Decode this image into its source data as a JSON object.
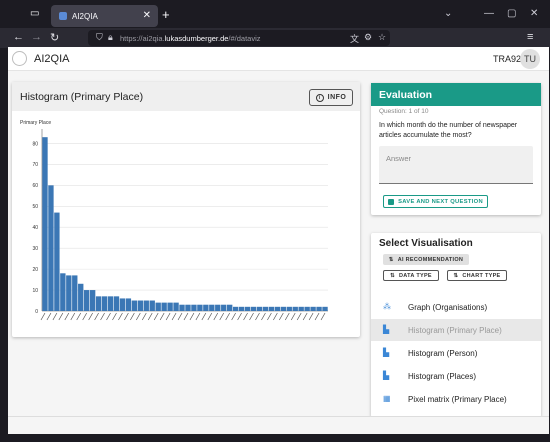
{
  "browser": {
    "tab_title": "AI2QIA",
    "url_prefix": "https://ai2qia.",
    "url_host": "lukasdumberger.de",
    "url_suffix": "/#/dataviz"
  },
  "app": {
    "title": "AI2QIA",
    "user_id": "TRA92",
    "avatar_initials": "TU"
  },
  "histogram_card": {
    "title": "Histogram (Primary Place)",
    "info_label": "INFO"
  },
  "evaluation": {
    "title": "Evaluation",
    "question_number": "Question: 1 of 10",
    "question": "In which month do the number of newspaper articles accumulate the most?",
    "answer_placeholder": "Answer",
    "save_label": "SAVE AND NEXT QUESTION"
  },
  "visualisation": {
    "title": "Select Visualisation",
    "ai_recommendation_label": "AI RECOMMENDATION",
    "data_type_label": "DATA TYPE",
    "chart_type_label": "CHART TYPE",
    "items": [
      {
        "label": "Graph (Organisations)",
        "icon": "graph-icon",
        "selected": false
      },
      {
        "label": "Histogram (Primary Place)",
        "icon": "histogram-icon",
        "selected": true
      },
      {
        "label": "Histogram (Person)",
        "icon": "histogram-icon",
        "selected": false
      },
      {
        "label": "Histogram (Places)",
        "icon": "histogram-icon",
        "selected": false
      },
      {
        "label": "Pixel matrix (Primary Place)",
        "icon": "pixel-matrix-icon",
        "selected": false
      }
    ]
  },
  "colors": {
    "accent": "#1a9a87",
    "bar": "#3b77b5"
  },
  "chart_data": {
    "type": "bar",
    "ylabel": "Primary Place",
    "ylim": [
      0,
      85
    ],
    "yticks": [
      0,
      10,
      20,
      30,
      40,
      50,
      60,
      70,
      80
    ],
    "grid": true,
    "values": [
      83,
      60,
      47,
      18,
      17,
      17,
      13,
      10,
      10,
      7,
      7,
      7,
      7,
      6,
      6,
      5,
      5,
      5,
      5,
      4,
      4,
      4,
      4,
      3,
      3,
      3,
      3,
      3,
      3,
      3,
      3,
      3,
      2,
      2,
      2,
      2,
      2,
      2,
      2,
      2,
      2,
      2,
      2,
      2,
      2,
      2,
      2,
      2
    ]
  }
}
